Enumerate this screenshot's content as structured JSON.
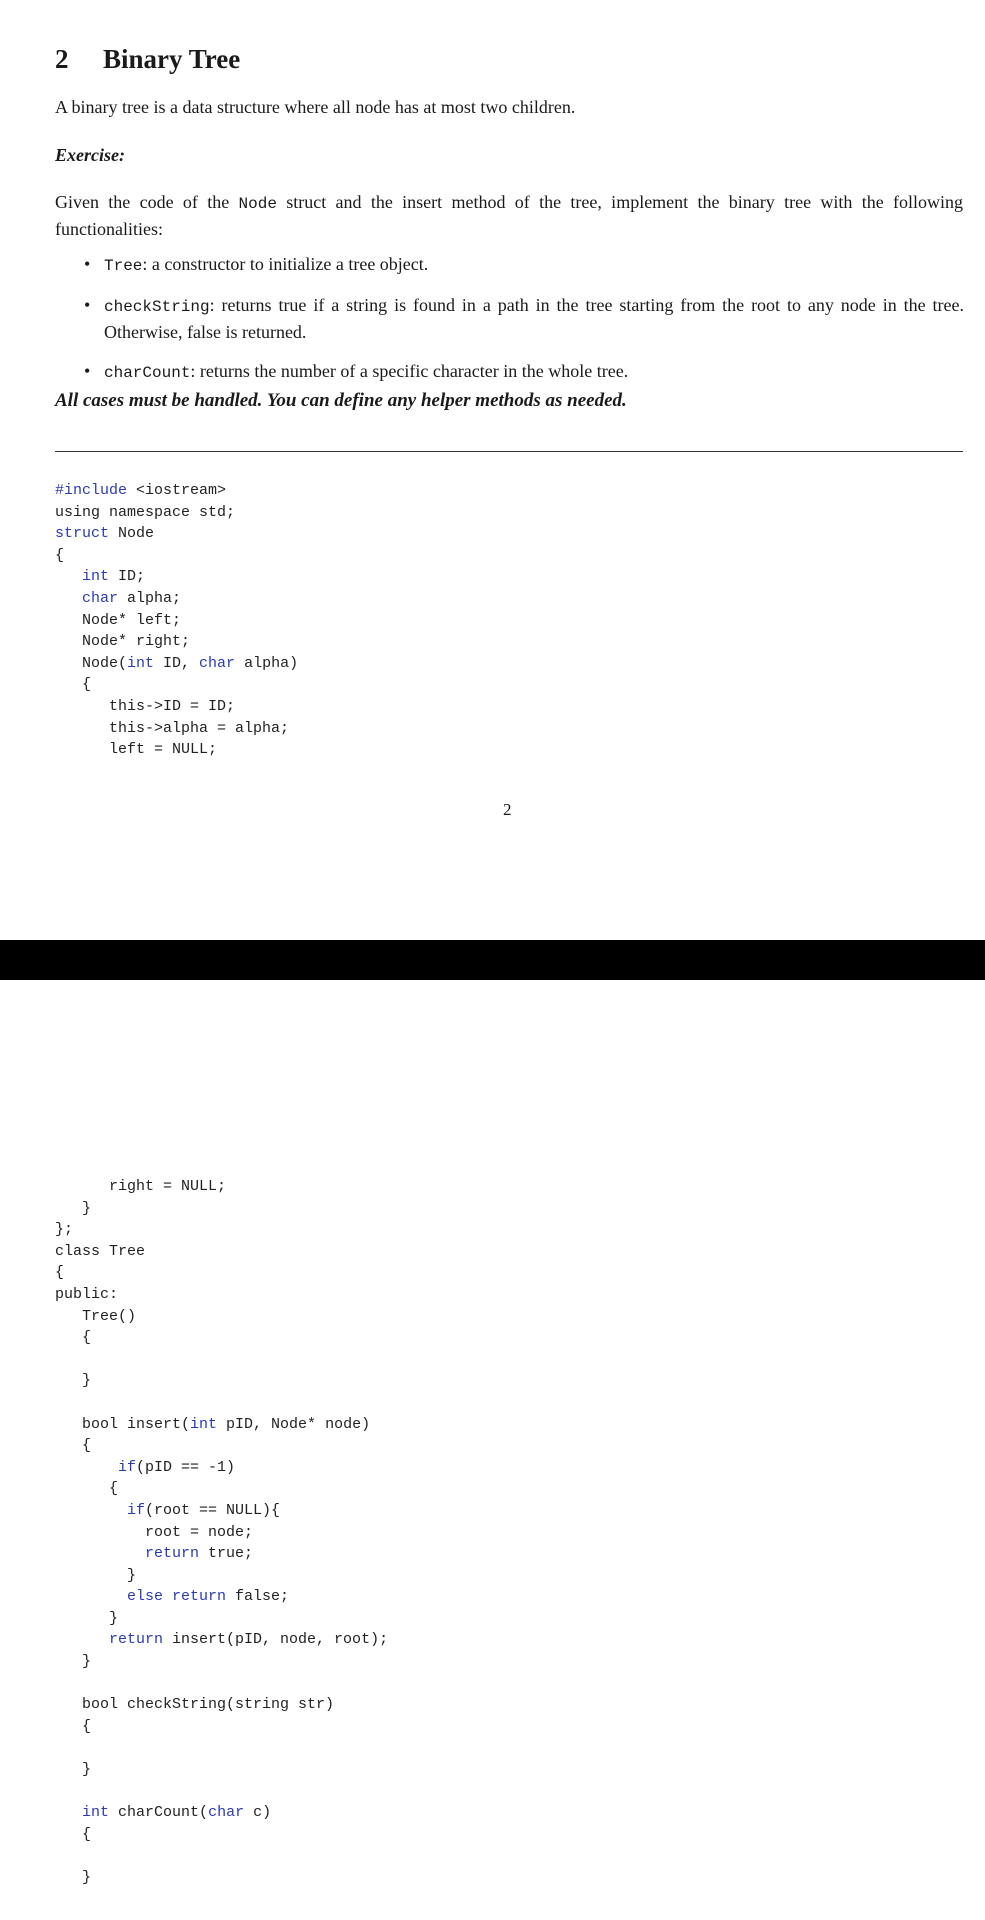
{
  "section": {
    "number": "2",
    "title": "Binary Tree"
  },
  "intro": "A binary tree is a data structure where all node has at most two children.",
  "exercise_label": "Exercise:",
  "task": {
    "pre": "Given the code of the ",
    "code_word": "Node",
    "post": " struct and the insert method of the tree, implement the binary tree with the following functionalities:"
  },
  "bullets": [
    {
      "term": "Tree",
      "desc": ": a constructor to initialize a tree object."
    },
    {
      "term": "checkString",
      "desc": ": returns true if a string is found in a path in the tree starting from the root to any node in the tree. Otherwise, false is returned."
    },
    {
      "term": "charCount",
      "desc": ": returns the number of a specific character in the whole tree."
    }
  ],
  "note": "All cases must be handled.  You can define any helper methods as needed.",
  "page_number": "2",
  "code_page1": [
    [
      {
        "t": "#include",
        "k": 1
      },
      {
        "t": " <iostream>"
      }
    ],
    [
      {
        "t": "using namespace std;"
      }
    ],
    [
      {
        "t": "struct",
        "k": 1
      },
      {
        "t": " Node"
      }
    ],
    [
      {
        "t": "{"
      }
    ],
    [
      {
        "t": "   "
      },
      {
        "t": "int",
        "k": 1
      },
      {
        "t": " ID;"
      }
    ],
    [
      {
        "t": "   "
      },
      {
        "t": "char",
        "k": 1
      },
      {
        "t": " alpha;"
      }
    ],
    [
      {
        "t": "   Node* left;"
      }
    ],
    [
      {
        "t": "   Node* right;"
      }
    ],
    [
      {
        "t": "   Node("
      },
      {
        "t": "int",
        "k": 1
      },
      {
        "t": " ID, "
      },
      {
        "t": "char",
        "k": 1
      },
      {
        "t": " alpha)"
      }
    ],
    [
      {
        "t": "   {"
      }
    ],
    [
      {
        "t": "      this->ID = ID;"
      }
    ],
    [
      {
        "t": "      this->alpha = alpha;"
      }
    ],
    [
      {
        "t": "      left = NULL;"
      }
    ]
  ],
  "code_page2": [
    [
      {
        "t": "      right = NULL;"
      }
    ],
    [
      {
        "t": "   }"
      }
    ],
    [
      {
        "t": "};"
      }
    ],
    [
      {
        "t": "class Tree"
      }
    ],
    [
      {
        "t": "{"
      }
    ],
    [
      {
        "t": "public:"
      }
    ],
    [
      {
        "t": "   Tree()"
      }
    ],
    [
      {
        "t": "   {"
      }
    ],
    [
      {
        "t": ""
      }
    ],
    [
      {
        "t": "   }"
      }
    ],
    [
      {
        "t": ""
      }
    ],
    [
      {
        "t": "   bool insert("
      },
      {
        "t": "int",
        "k": 1
      },
      {
        "t": " pID, Node* node)"
      }
    ],
    [
      {
        "t": "   {"
      }
    ],
    [
      {
        "t": "       "
      },
      {
        "t": "if",
        "k": 1
      },
      {
        "t": "(pID == -1)"
      }
    ],
    [
      {
        "t": "      {"
      }
    ],
    [
      {
        "t": "        "
      },
      {
        "t": "if",
        "k": 1
      },
      {
        "t": "(root == NULL){"
      }
    ],
    [
      {
        "t": "          root = node;"
      }
    ],
    [
      {
        "t": "          "
      },
      {
        "t": "return",
        "k": 1
      },
      {
        "t": " true;"
      }
    ],
    [
      {
        "t": "        }"
      }
    ],
    [
      {
        "t": "        "
      },
      {
        "t": "else return",
        "k": 1
      },
      {
        "t": " false;"
      }
    ],
    [
      {
        "t": "      }"
      }
    ],
    [
      {
        "t": "      "
      },
      {
        "t": "return",
        "k": 1
      },
      {
        "t": " insert(pID, node, root);"
      }
    ],
    [
      {
        "t": "   }"
      }
    ],
    [
      {
        "t": ""
      }
    ],
    [
      {
        "t": "   bool checkString(string str)"
      }
    ],
    [
      {
        "t": "   {"
      }
    ],
    [
      {
        "t": ""
      }
    ],
    [
      {
        "t": "   }"
      }
    ],
    [
      {
        "t": ""
      }
    ],
    [
      {
        "t": "   "
      },
      {
        "t": "int",
        "k": 1
      },
      {
        "t": " charCount("
      },
      {
        "t": "char",
        "k": 1
      },
      {
        "t": " c)"
      }
    ],
    [
      {
        "t": "   {"
      }
    ],
    [
      {
        "t": ""
      }
    ],
    [
      {
        "t": "   }"
      }
    ]
  ]
}
